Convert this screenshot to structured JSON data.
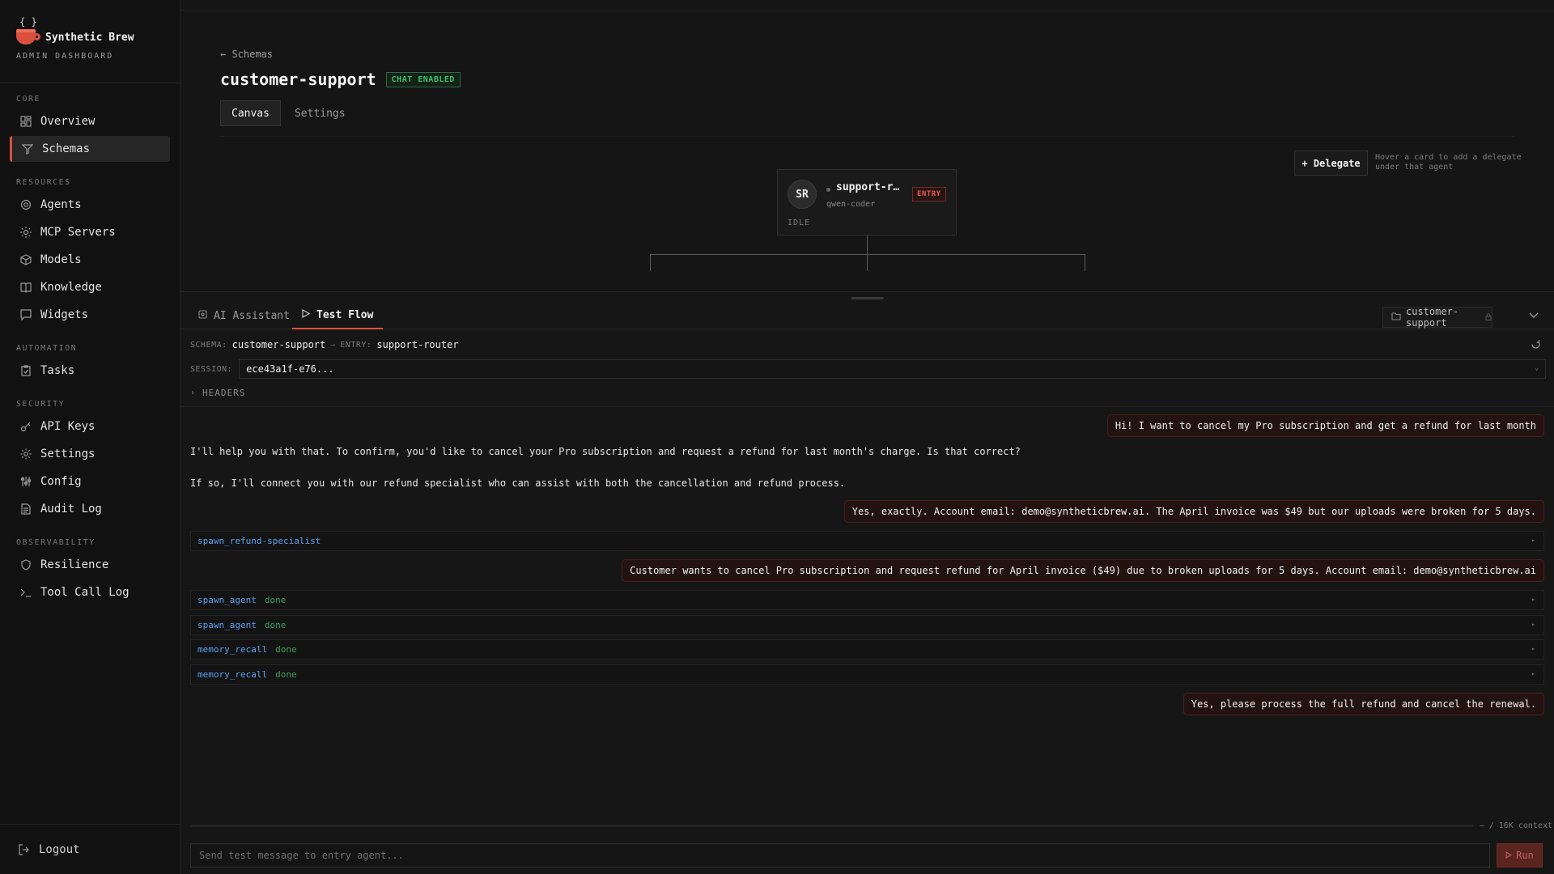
{
  "brand": {
    "braces": "{ }",
    "name": "Synthetic Brew",
    "subtitle": "ADMIN DASHBOARD"
  },
  "sidebar": {
    "sections": [
      {
        "label": "CORE",
        "items": [
          {
            "label": "Overview",
            "icon": "grid-icon"
          },
          {
            "label": "Schemas",
            "icon": "branch-icon",
            "active": true
          }
        ]
      },
      {
        "label": "RESOURCES",
        "items": [
          {
            "label": "Agents",
            "icon": "gear-icon"
          },
          {
            "label": "MCP Servers",
            "icon": "sun-icon"
          },
          {
            "label": "Models",
            "icon": "cube-icon"
          },
          {
            "label": "Knowledge",
            "icon": "book-icon"
          },
          {
            "label": "Widgets",
            "icon": "chat-icon"
          }
        ]
      },
      {
        "label": "AUTOMATION",
        "items": [
          {
            "label": "Tasks",
            "icon": "clipboard-icon"
          }
        ]
      },
      {
        "label": "SECURITY",
        "items": [
          {
            "label": "API Keys",
            "icon": "key-icon"
          },
          {
            "label": "Settings",
            "icon": "settings-icon"
          },
          {
            "label": "Config",
            "icon": "sliders-icon"
          },
          {
            "label": "Audit Log",
            "icon": "document-icon"
          }
        ]
      },
      {
        "label": "OBSERVABILITY",
        "items": [
          {
            "label": "Resilience",
            "icon": "shield-icon"
          },
          {
            "label": "Tool Call Log",
            "icon": "terminal-icon"
          }
        ]
      }
    ],
    "logout": "Logout"
  },
  "header": {
    "back_link": "← Schemas",
    "title": "customer-support",
    "badge": "CHAT ENABLED",
    "tabs": [
      {
        "label": "Canvas",
        "active": true
      },
      {
        "label": "Settings"
      }
    ]
  },
  "canvas": {
    "delegate_button": "+ Delegate",
    "delegate_hint": "Hover a card to add a delegate under that agent",
    "agent": {
      "initials": "SR",
      "name": "support-r…",
      "model": "qwen-coder",
      "badge": "ENTRY",
      "state": "IDLE"
    }
  },
  "panel": {
    "tabs": [
      {
        "label": "AI Assistant",
        "icon": "assistant-icon"
      },
      {
        "label": "Test Flow",
        "icon": "play-icon",
        "active": true
      }
    ],
    "schema_chip": "customer-support",
    "meta": {
      "schema_key": "SCHEMA:",
      "schema_val": "customer-support",
      "sep": "→",
      "entry_key": "ENTRY:",
      "entry_val": "support-router"
    },
    "session_key": "SESSION:",
    "session_val": "ece43a1f-e76...",
    "headers_label": "HEADERS",
    "messages": {
      "user_1": "Hi! I want to cancel my Pro subscription and get a refund for last month",
      "assistant_1a": "I'll help you with that. To confirm, you'd like to cancel your Pro subscription and request a refund for last month's charge. Is that correct?",
      "assistant_1b": "If so, I'll connect you with our refund specialist who can assist with both the cancellation and refund process.",
      "user_2": "Yes, exactly. Account email: demo@syntheticbrew.ai. The April invoice was $49 but our uploads were broken for 5 days.",
      "tool_1": {
        "name": "spawn_refund-specialist",
        "status": ""
      },
      "user_3": "Customer wants to cancel Pro subscription and request refund for April invoice ($49) due to broken uploads for 5 days. Account email: demo@syntheticbrew.ai",
      "tool_2": {
        "name": "spawn_agent",
        "status": "done"
      },
      "tool_3": {
        "name": "spawn_agent",
        "status": "done"
      },
      "tool_4": {
        "name": "memory_recall",
        "status": "done"
      },
      "tool_5": {
        "name": "memory_recall",
        "status": "done"
      },
      "user_4": "Yes, please process the full refund and cancel the renewal."
    },
    "context_label": "— / 16K context",
    "input_placeholder": "Send test message to entry agent...",
    "run_button": "Run"
  }
}
